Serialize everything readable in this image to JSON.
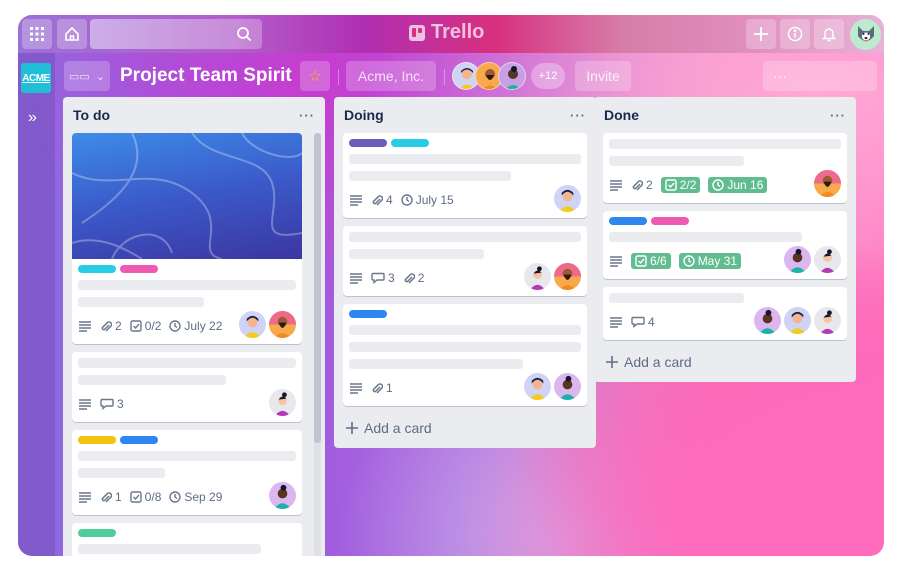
{
  "app": {
    "name": "Trello"
  },
  "topbar": {
    "apps_icon": "grid-icon",
    "home_icon": "home-icon",
    "search_placeholder": "",
    "search_icon": "search-icon",
    "logo": "Trello",
    "create_icon": "plus-icon",
    "info_icon": "info-icon",
    "notifications_icon": "bell-icon",
    "profile_avatar": "husky-avatar"
  },
  "sidebar": {
    "workspace_badge": "ACME",
    "expand_icon": "double-chevron-right-icon"
  },
  "board": {
    "view_switcher_icon": "board-view-icon",
    "title": "Project Team Spirit",
    "starred": true,
    "workspace": "Acme, Inc.",
    "members_extra": "+12",
    "invite_label": "Invite",
    "menu_label": "···"
  },
  "colors": {
    "accent": "#0079bf",
    "label_cyan": "#29cce5",
    "label_pink": "#ef5ab1",
    "label_purple": "#6b5db8",
    "label_blue": "#2e86f0",
    "label_yellow": "#f5c20f",
    "label_green": "#4bce97",
    "done_badge": "#61bd8f"
  },
  "lists": [
    {
      "title": "To do",
      "menu": "···",
      "cards": [
        {
          "cover": true,
          "labels": [
            "#29cce5",
            "#ef5ab1"
          ],
          "bars": [
            1,
            0.58
          ],
          "badges": {
            "description": true,
            "attachments": "2",
            "checklist": "0/2",
            "due": "July 22"
          },
          "members": [
            "yellow-person",
            "bearded-person"
          ]
        },
        {
          "labels": [],
          "bars": [
            1,
            0.68
          ],
          "badges": {
            "description": true,
            "comments": "3"
          },
          "members": [
            "bun-person"
          ]
        },
        {
          "labels": [
            "#f5c20f",
            "#2e86f0"
          ],
          "bars": [
            1,
            0.4
          ],
          "badges": {
            "description": true,
            "attachments": "1",
            "checklist": "0/8",
            "due": "Sep 29"
          },
          "members": [
            "teal-person"
          ]
        },
        {
          "labels": [
            "#4bce97"
          ],
          "bars": [
            0.84
          ],
          "badges": {},
          "members": []
        }
      ]
    },
    {
      "title": "Doing",
      "menu": "···",
      "cards": [
        {
          "labels": [
            "#6b5db8",
            "#29cce5"
          ],
          "bars": [
            1,
            0.7
          ],
          "badges": {
            "description": true,
            "attachments": "4",
            "due": "July 15"
          },
          "members": [
            "yellow-person"
          ]
        },
        {
          "labels": [],
          "bars": [
            1,
            0.58
          ],
          "badges": {
            "description": true,
            "comments": "3",
            "attachments": "2"
          },
          "members": [
            "bun-person",
            "bearded-person"
          ]
        },
        {
          "labels": [
            "#2e86f0"
          ],
          "bars": [
            1,
            1,
            0.75
          ],
          "badges": {
            "description": true,
            "attachments": "1"
          },
          "members": [
            "yellow-person",
            "teal-person"
          ]
        }
      ],
      "add_card": "Add a card"
    },
    {
      "title": "Done",
      "menu": "···",
      "cards": [
        {
          "labels": [],
          "bars": [
            1,
            0.58
          ],
          "badges": {
            "description": true,
            "attachments": "2",
            "checklist_done": "2/2",
            "due_done": "Jun 16"
          },
          "members": [
            "bearded-person"
          ]
        },
        {
          "labels": [
            "#2e86f0",
            "#ef5ab1"
          ],
          "bars": [
            0.83
          ],
          "badges": {
            "description": true,
            "checklist_done": "6/6",
            "due_done": "May 31"
          },
          "members": [
            "teal-person",
            "bun-person"
          ]
        },
        {
          "labels": [],
          "bars": [
            0.58
          ],
          "badges": {
            "description": true,
            "comments": "4"
          },
          "members": [
            "teal-person",
            "yellow-person",
            "bun-person"
          ]
        }
      ],
      "add_card": "Add a card"
    }
  ]
}
